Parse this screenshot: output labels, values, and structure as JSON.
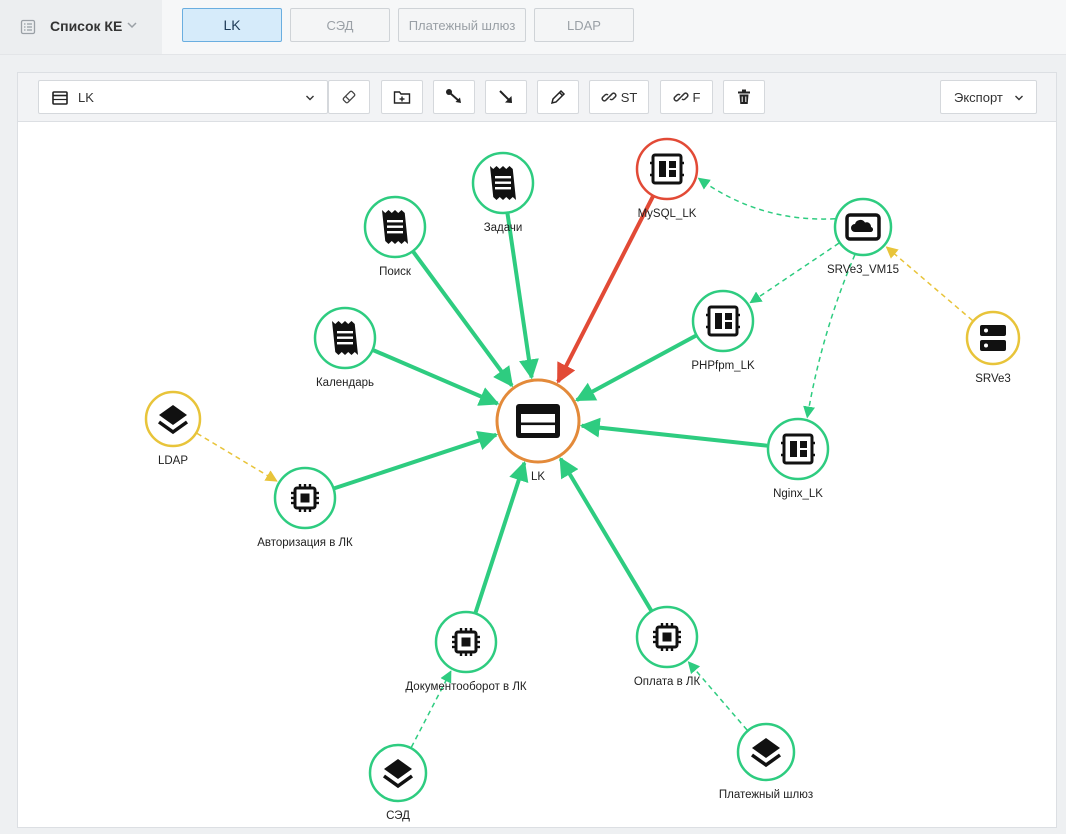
{
  "header": {
    "list_label": "Список КЕ",
    "list_icon": "list-icon",
    "tabs": [
      {
        "label": "LK",
        "active": true
      },
      {
        "label": "СЭД",
        "active": false
      },
      {
        "label": "Платежный шлюз",
        "active": false
      },
      {
        "label": "LDAP",
        "active": false
      }
    ]
  },
  "toolbar": {
    "selected_ke": "LK",
    "selected_icon": "window-icon",
    "buttons": [
      {
        "name": "clear-button",
        "icon": "eraser-icon",
        "label": ""
      },
      {
        "name": "add-node-button",
        "icon": "folder-plus-icon",
        "label": ""
      },
      {
        "name": "add-link-button",
        "icon": "link-nodes-icon",
        "label": ""
      },
      {
        "name": "add-arrow-button",
        "icon": "arrow-down-right-icon",
        "label": ""
      },
      {
        "name": "edit-button",
        "icon": "pencil-icon",
        "label": ""
      },
      {
        "name": "link-st-button",
        "icon": "link-icon",
        "label": "ST"
      },
      {
        "name": "link-f-button",
        "icon": "link-icon",
        "label": "F"
      },
      {
        "name": "delete-button",
        "icon": "trash-icon",
        "label": ""
      }
    ],
    "export_label": "Экспорт"
  },
  "colors": {
    "green": "#2ecc80",
    "red": "#e24a36",
    "yellow": "#e8c43a",
    "orange": "#e38a3a",
    "accent_blue": "#6aaee0"
  },
  "graph": {
    "nodes": [
      {
        "id": "lk",
        "label": "LK",
        "icon": "window-icon",
        "status": "orange"
      },
      {
        "id": "poisk",
        "label": "Поиск",
        "icon": "receipt-icon",
        "status": "green"
      },
      {
        "id": "zadachi",
        "label": "Задачи",
        "icon": "receipt-icon",
        "status": "green"
      },
      {
        "id": "mysql",
        "label": "MySQL_LK",
        "icon": "dashboard-icon",
        "status": "red"
      },
      {
        "id": "srve3vm",
        "label": "SRVe3_VM15",
        "icon": "cloud-icon",
        "status": "green"
      },
      {
        "id": "phpfpm",
        "label": "PHPfpm_LK",
        "icon": "dashboard-icon",
        "status": "green"
      },
      {
        "id": "srve3",
        "label": "SRVe3",
        "icon": "server-icon",
        "status": "yellow"
      },
      {
        "id": "calendar",
        "label": "Календарь",
        "icon": "receipt-icon",
        "status": "green"
      },
      {
        "id": "ldap",
        "label": "LDAP",
        "icon": "layers-icon",
        "status": "yellow"
      },
      {
        "id": "nginx",
        "label": "Nginx_LK",
        "icon": "dashboard-icon",
        "status": "green"
      },
      {
        "id": "auth",
        "label": "Авторизация в ЛК",
        "icon": "chip-icon",
        "status": "green"
      },
      {
        "id": "docflow",
        "label": "Документооборот в ЛК",
        "icon": "chip-icon",
        "status": "green"
      },
      {
        "id": "payment",
        "label": "Оплата в ЛК",
        "icon": "chip-icon",
        "status": "green"
      },
      {
        "id": "sed",
        "label": "СЭД",
        "icon": "layers-icon",
        "status": "green"
      },
      {
        "id": "gateway",
        "label": "Платежный шлюз",
        "icon": "layers-icon",
        "status": "green"
      }
    ],
    "edges": [
      {
        "from": "poisk",
        "to": "lk",
        "style": "solid",
        "color": "green"
      },
      {
        "from": "zadachi",
        "to": "lk",
        "style": "solid",
        "color": "green"
      },
      {
        "from": "mysql",
        "to": "lk",
        "style": "solid",
        "color": "red"
      },
      {
        "from": "calendar",
        "to": "lk",
        "style": "solid",
        "color": "green"
      },
      {
        "from": "phpfpm",
        "to": "lk",
        "style": "solid",
        "color": "green"
      },
      {
        "from": "nginx",
        "to": "lk",
        "style": "solid",
        "color": "green"
      },
      {
        "from": "auth",
        "to": "lk",
        "style": "solid",
        "color": "green"
      },
      {
        "from": "docflow",
        "to": "lk",
        "style": "solid",
        "color": "green"
      },
      {
        "from": "payment",
        "to": "lk",
        "style": "solid",
        "color": "green"
      },
      {
        "from": "srve3vm",
        "to": "mysql",
        "style": "dashed",
        "color": "green"
      },
      {
        "from": "srve3vm",
        "to": "phpfpm",
        "style": "dashed",
        "color": "green"
      },
      {
        "from": "srve3vm",
        "to": "nginx",
        "style": "dashed",
        "color": "green"
      },
      {
        "from": "srve3",
        "to": "srve3vm",
        "style": "dashed",
        "color": "yellow"
      },
      {
        "from": "ldap",
        "to": "auth",
        "style": "dashed",
        "color": "yellow"
      },
      {
        "from": "sed",
        "to": "docflow",
        "style": "dashed",
        "color": "green"
      },
      {
        "from": "gateway",
        "to": "payment",
        "style": "dashed",
        "color": "green"
      }
    ]
  }
}
